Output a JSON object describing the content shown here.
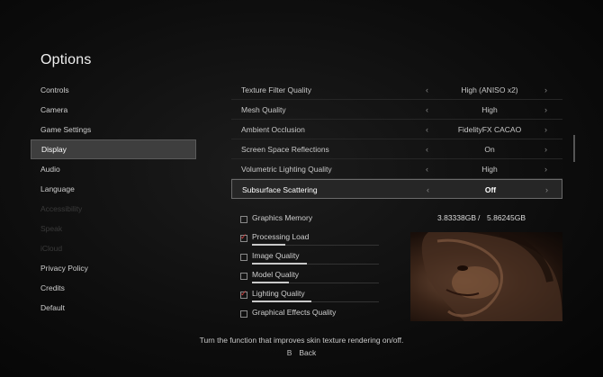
{
  "menu": {
    "title": "Options"
  },
  "sidebar": {
    "items": [
      {
        "label": "Controls"
      },
      {
        "label": "Camera"
      },
      {
        "label": "Game Settings"
      },
      {
        "label": "Display"
      },
      {
        "label": "Audio"
      },
      {
        "label": "Language"
      },
      {
        "label": "Accessibility"
      },
      {
        "label": "Speak"
      },
      {
        "label": "iCloud"
      },
      {
        "label": "Privacy Policy"
      },
      {
        "label": "Credits"
      },
      {
        "label": "Default"
      }
    ],
    "active_index": 3,
    "disabled_indices": [
      6,
      7,
      8
    ]
  },
  "settings": {
    "rows": [
      {
        "label": "Texture Filter Quality",
        "value": "High (ANISO x2)"
      },
      {
        "label": "Mesh Quality",
        "value": "High"
      },
      {
        "label": "Ambient Occlusion",
        "value": "FidelityFX CACAO"
      },
      {
        "label": "Screen Space Reflections",
        "value": "On"
      },
      {
        "label": "Volumetric Lighting Quality",
        "value": "High"
      },
      {
        "label": "Subsurface Scattering",
        "value": "Off"
      }
    ],
    "selected_index": 5,
    "arrow_left": "‹",
    "arrow_right": "›"
  },
  "graphics_memory": {
    "label": "Graphics Memory",
    "used": "3.83338GB",
    "separator": "/",
    "total": "5.86245GB"
  },
  "metrics": [
    {
      "label": "Processing Load",
      "checked": true,
      "level": 0.26
    },
    {
      "label": "Image Quality",
      "checked": false,
      "level": 0.43
    },
    {
      "label": "Model Quality",
      "checked": false,
      "level": 0.29
    },
    {
      "label": "Lighting Quality",
      "checked": true,
      "level": 0.47
    },
    {
      "label": "Graphical Effects Quality",
      "checked": false,
      "level": 0.0
    }
  ],
  "footer": {
    "hint": "Turn the function that improves skin texture rendering on/off.",
    "back_button": "B",
    "back_label": "Back"
  },
  "colors": {
    "check_mark": "#d84040",
    "selected_bg": "#3e3e3e"
  }
}
